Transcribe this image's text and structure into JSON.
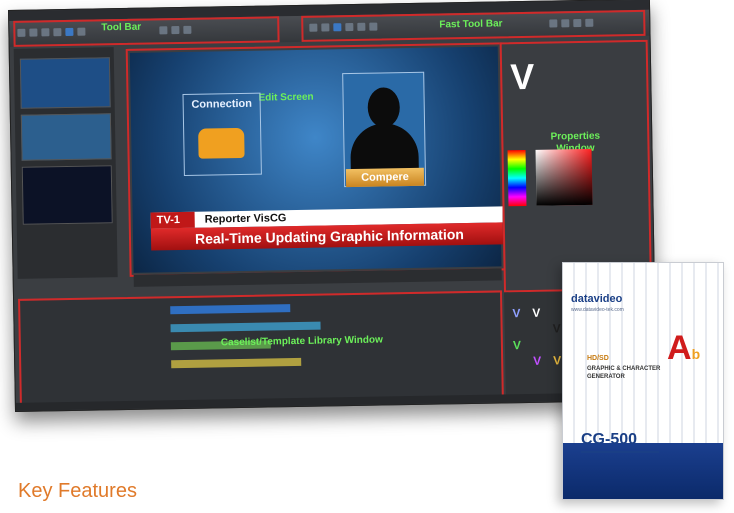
{
  "labels": {
    "tool_bar": "Tool Bar",
    "fast_tool_bar": "Fast Tool Bar",
    "edit_screen": "Edit Screen",
    "properties_window": "Properties Window",
    "caselist_template_library_window": "Caselist/Template Library Window"
  },
  "edit_screen": {
    "connection": "Connection",
    "compere": "Compere",
    "tv_label": "TV-1",
    "reporter": "Reporter VisCG",
    "headline": "Real-Time Updating Graphic Information"
  },
  "properties": {
    "letter": "V"
  },
  "product_box": {
    "brand": "datavideo",
    "brand_sub": "www.datavideo-tek.com",
    "hd_sd": "HD/SD",
    "desc1": "GRAPHIC & CHARACTER",
    "desc2": "GENERATOR",
    "ab": "A",
    "ab_sub": "b",
    "model": "CG-500"
  },
  "heading": "Key Features",
  "colors": {
    "highlight_border": "#d02a2a",
    "label_green": "#6cf05a",
    "heading_orange": "#e07a2a",
    "brand_blue": "#1a3f86"
  }
}
